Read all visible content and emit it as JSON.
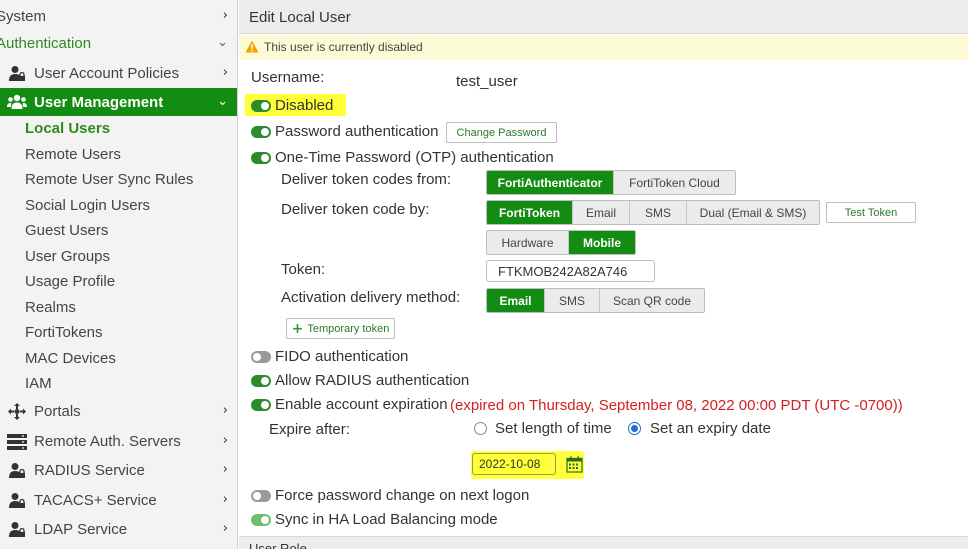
{
  "sidebar": {
    "system": "System",
    "authentication": "Authentication",
    "user_account_policies": "User Account Policies",
    "user_management": "User Management",
    "sub_items": [
      "Local Users",
      "Remote Users",
      "Remote User Sync Rules",
      "Social Login Users",
      "Guest Users",
      "User Groups",
      "Usage Profile",
      "Realms",
      "FortiTokens",
      "MAC Devices",
      "IAM"
    ],
    "portals": "Portals",
    "remote_auth_servers": "Remote Auth. Servers",
    "radius_service": "RADIUS Service",
    "tacacs_service": "TACACS+ Service",
    "ldap_service": "LDAP Service"
  },
  "header": {
    "title": "Edit Local User"
  },
  "warning": {
    "text": "This user is currently disabled"
  },
  "form": {
    "username_label": "Username:",
    "username_value": "test_user",
    "disabled_label": "Disabled",
    "password_auth_label": "Password authentication",
    "change_password": "Change Password",
    "otp_label": "One-Time Password (OTP) authentication",
    "deliver_from_label": "Deliver token codes from:",
    "deliver_from_options": [
      "FortiAuthenticator",
      "FortiToken Cloud"
    ],
    "deliver_by_label": "Deliver token code by:",
    "deliver_by_options": [
      "FortiToken",
      "Email",
      "SMS",
      "Dual (Email & SMS)"
    ],
    "test_token": "Test Token",
    "token_type_options": [
      "Hardware",
      "Mobile"
    ],
    "token_label": "Token:",
    "token_value": "FTKMOB242A82A746",
    "activation_label": "Activation delivery method:",
    "activation_options": [
      "Email",
      "SMS",
      "Scan QR code"
    ],
    "temporary_token": "Temporary token",
    "fido_label": "FIDO authentication",
    "radius_label": "Allow RADIUS authentication",
    "expiration_label": "Enable account expiration",
    "expiration_note": "(expired on Thursday, September 08, 2022 00:00 PDT (UTC -0700))",
    "expire_after_label": "Expire after:",
    "expire_options": [
      "Set length of time",
      "Set an expiry date"
    ],
    "expiry_date": "2022-10-08",
    "force_password_label": "Force password change on next logon",
    "sync_ha_label": "Sync in HA Load Balancing mode",
    "user_role_label": "User Role"
  },
  "colors": {
    "accent": "#128c12",
    "highlight": "#ffff3a",
    "error": "#d42020",
    "warning_bg": "#fdfbd5"
  }
}
